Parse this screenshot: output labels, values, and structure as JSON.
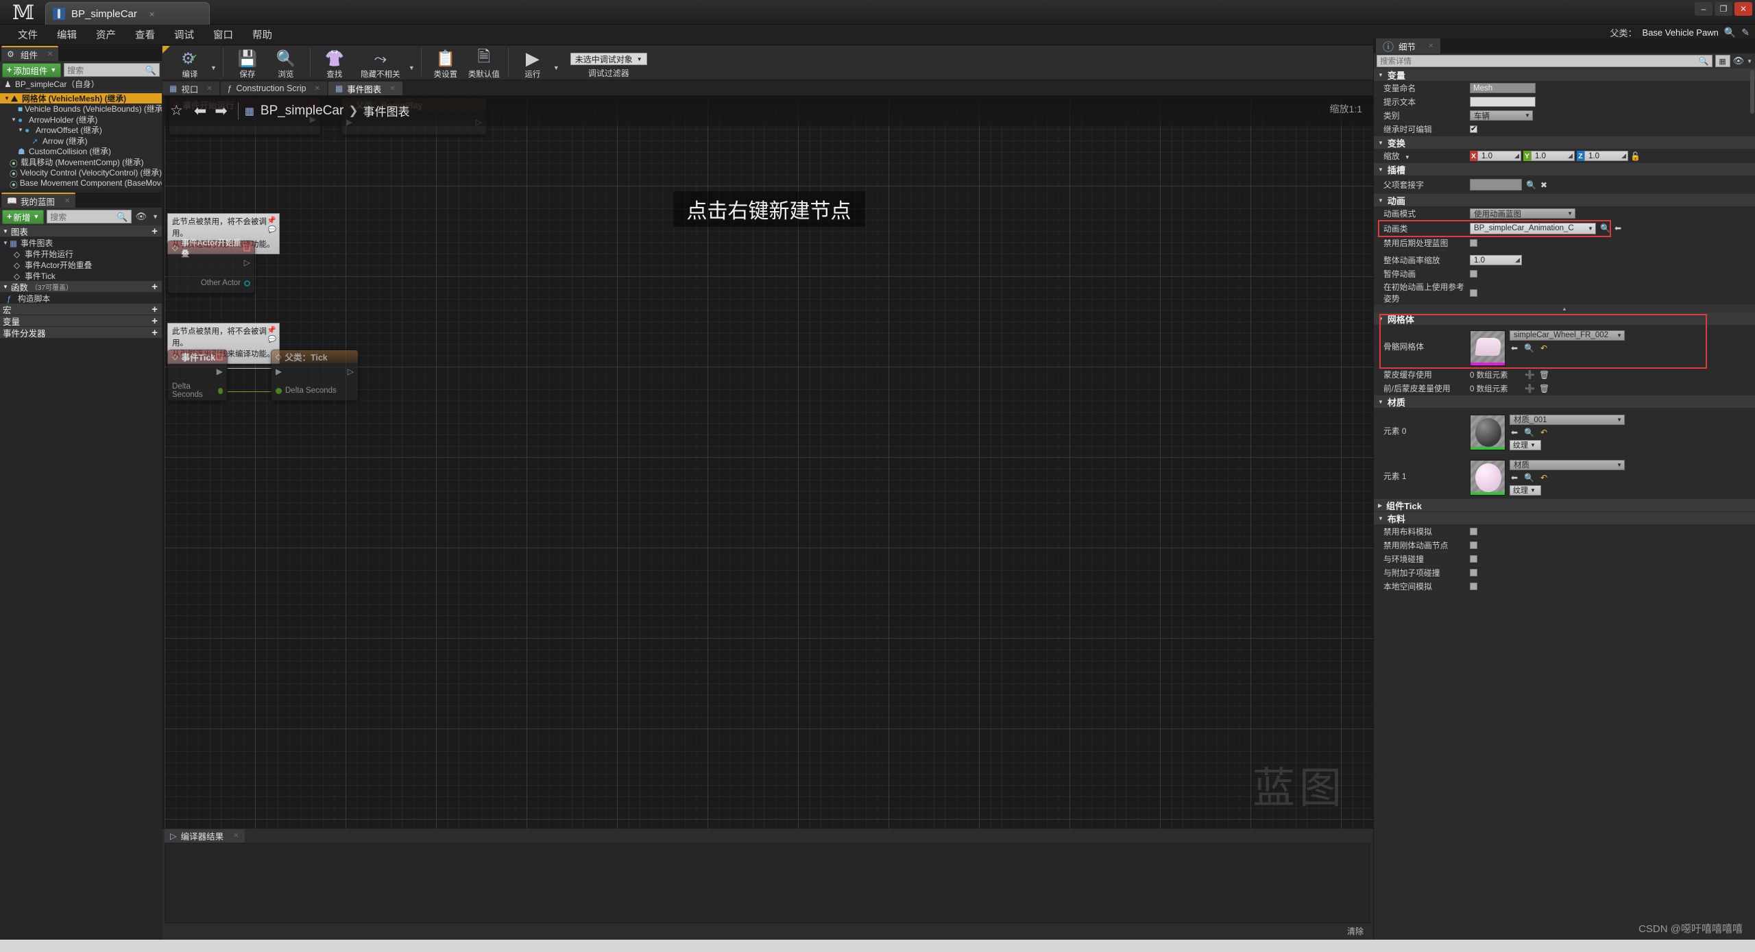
{
  "window": {
    "tab_title": "BP_simpleCar",
    "tab_close": "×",
    "minimize": "–",
    "maximize": "❐",
    "close": "✕"
  },
  "menubar": {
    "items": [
      {
        "label": "文件"
      },
      {
        "label": "编辑"
      },
      {
        "label": "资产"
      },
      {
        "label": "查看"
      },
      {
        "label": "调试"
      },
      {
        "label": "窗口"
      },
      {
        "label": "帮助"
      }
    ],
    "parent_label": "父类：",
    "parent_value": "Base Vehicle Pawn"
  },
  "components_panel": {
    "tab_label": "组件",
    "add_button": "添加组件",
    "search_placeholder": "搜索",
    "root": "BP_simpleCar（自身）",
    "items": [
      {
        "label": "网格体 (VehicleMesh) (继承)",
        "indent": 0,
        "selected": true,
        "icon": "mesh-icon",
        "arrow": true
      },
      {
        "label": "Vehicle Bounds (VehicleBounds) (继承)",
        "indent": 1,
        "selected": false,
        "icon": "box-icon",
        "arrow": false
      },
      {
        "label": "ArrowHolder (继承)",
        "indent": 1,
        "selected": false,
        "icon": "scene-icon",
        "arrow": true
      },
      {
        "label": "ArrowOffset (继承)",
        "indent": 2,
        "selected": false,
        "icon": "scene-icon",
        "arrow": true
      },
      {
        "label": "Arrow (继承)",
        "indent": 3,
        "selected": false,
        "icon": "arrow-icon",
        "arrow": false
      },
      {
        "label": "CustomCollision (继承)",
        "indent": 1,
        "selected": false,
        "icon": "collision-icon",
        "arrow": false
      },
      {
        "label": "载具移动 (MovementComp) (继承)",
        "indent": 0,
        "selected": false,
        "icon": "comp-icon",
        "arrow": false
      },
      {
        "label": "Velocity Control (VelocityControl) (继承)",
        "indent": 0,
        "selected": false,
        "icon": "comp-icon",
        "arrow": false
      },
      {
        "label": "Base Movement Component (BaseMovementC",
        "indent": 0,
        "selected": false,
        "icon": "comp-icon",
        "arrow": false
      }
    ]
  },
  "myblueprint_panel": {
    "tab_label": "我的蓝图",
    "add_button": "新增",
    "search_placeholder": "搜索",
    "sections": [
      {
        "label": "图表",
        "plus": "+",
        "sub": ""
      },
      {
        "label": "函数",
        "plus": "+",
        "sub": "（37可覆盖）"
      },
      {
        "label": "宏",
        "plus": "+",
        "sub": ""
      },
      {
        "label": "变量",
        "plus": "+",
        "sub": ""
      },
      {
        "label": "事件分发器",
        "plus": "+",
        "sub": ""
      }
    ],
    "event_graph_label": "事件图表",
    "events": [
      {
        "label": "事件开始运行"
      },
      {
        "label": "事件Actor开始重叠"
      },
      {
        "label": "事件Tick"
      }
    ],
    "construction_script": "构造脚本"
  },
  "toolbar": {
    "buttons": [
      {
        "label": "编译",
        "icon": "compile-icon",
        "has_caret": true
      },
      {
        "label": "保存",
        "icon": "save-icon",
        "has_caret": false
      },
      {
        "label": "浏览",
        "icon": "browse-icon",
        "has_caret": false
      },
      {
        "label": "查找",
        "icon": "find-icon",
        "has_caret": false
      },
      {
        "label": "隐藏不相关",
        "icon": "hide-unrelated-icon",
        "has_caret": true
      },
      {
        "label": "类设置",
        "icon": "class-settings-icon",
        "has_caret": false
      },
      {
        "label": "类默认值",
        "icon": "class-defaults-icon",
        "has_caret": false
      },
      {
        "label": "运行",
        "icon": "play-icon",
        "has_caret": true
      }
    ],
    "debug_selector": "未选中调试对象",
    "debug_label": "调试过滤器"
  },
  "graph": {
    "tabs": [
      {
        "label": "视口",
        "icon": "viewport-icon",
        "active": false
      },
      {
        "label": "Construction Scrip",
        "icon": "function-icon",
        "active": false
      },
      {
        "label": "事件图表",
        "icon": "graph-icon",
        "active": true
      }
    ],
    "breadcrumb_root": "BP_simpleCar",
    "breadcrumb_sep": "❯",
    "breadcrumb_leaf": "事件图表",
    "zoom_label": "缩放1:1",
    "hint_text": "点击右键新建节点",
    "watermark": "蓝图",
    "tooltip_text": "此节点被禁用，将不会被调用。\n从引脚连出引线来编译功能。",
    "nodes": [
      {
        "title": "事件开始运行",
        "style": "red"
      },
      {
        "title": "父类：BeginPlay",
        "style": "orange"
      },
      {
        "title": "事件Actor开始重叠",
        "style": "red",
        "out_pin": "Other Actor"
      },
      {
        "title": "事件Tick",
        "style": "red",
        "out_pin": "Delta Seconds"
      },
      {
        "title": "父类：Tick",
        "style": "orange",
        "in_pin": "Delta Seconds"
      }
    ]
  },
  "compiler": {
    "tab_label": "编译器结果",
    "clear_label": "清除"
  },
  "details": {
    "tab_label": "细节",
    "search_placeholder": "搜索详情",
    "sections": {
      "variable": {
        "title": "变量",
        "rows": [
          {
            "label": "变量命名",
            "value": "Mesh",
            "kind": "text"
          },
          {
            "label": "提示文本",
            "value": "",
            "kind": "text-light"
          },
          {
            "label": "类别",
            "value": "车辆",
            "kind": "select"
          },
          {
            "label": "继承时可编辑",
            "value": "",
            "kind": "checkbox-on"
          }
        ]
      },
      "transform": {
        "title": "变换",
        "scale_label": "缩放",
        "scale": {
          "x": "1.0",
          "y": "1.0",
          "z": "1.0"
        }
      },
      "socket": {
        "title": "插槽",
        "rows": [
          {
            "label": "父项套接字",
            "value": "",
            "kind": "text"
          }
        ]
      },
      "animation": {
        "title": "动画",
        "mode_label": "动画模式",
        "mode_value": "使用动画蓝图",
        "class_label": "动画类",
        "class_value": "BP_simpleCar_Animation_C",
        "disable_postprocess_label": "禁用后期处理蓝图",
        "rate_label": "整体动画率缩放",
        "rate_value": "1.0",
        "pause_label": "暂停动画",
        "refpose_label": "在初始动画上使用参考姿势"
      },
      "mesh": {
        "title": "网格体",
        "skeletal_label": "骨骼网格体",
        "skeletal_value": "simpleCar_Wheel_FR_002",
        "skin_cache_label": "蒙皮缓存使用",
        "skin_cache_value": "0 数组元素",
        "skin_delta_label": "前/后蒙皮差量使用",
        "skin_delta_value": "0 数组元素"
      },
      "materials": {
        "title": "材质",
        "elements": [
          {
            "label": "元素 0",
            "value": "材质_001",
            "texture_button": "纹理",
            "thumb": "dark-sphere"
          },
          {
            "label": "元素 1",
            "value": "材质",
            "texture_button": "纹理",
            "thumb": "pink-sphere"
          }
        ]
      },
      "component_tick": {
        "title": "组件Tick"
      },
      "cloth": {
        "title": "布料",
        "rows": [
          {
            "label": "禁用布料模拟"
          },
          {
            "label": "禁用刚体动画节点"
          },
          {
            "label": "与环境碰撞"
          },
          {
            "label": "与附加子项碰撞"
          },
          {
            "label": "本地空间模拟"
          }
        ]
      }
    }
  },
  "watermark": {
    "csdn": "CSDN @噁吁嘻嘻嘻嘻"
  },
  "colors": {
    "accent_orange": "#e0a01e",
    "green_button": "#55a84c",
    "highlight_red": "#e03a3a"
  }
}
